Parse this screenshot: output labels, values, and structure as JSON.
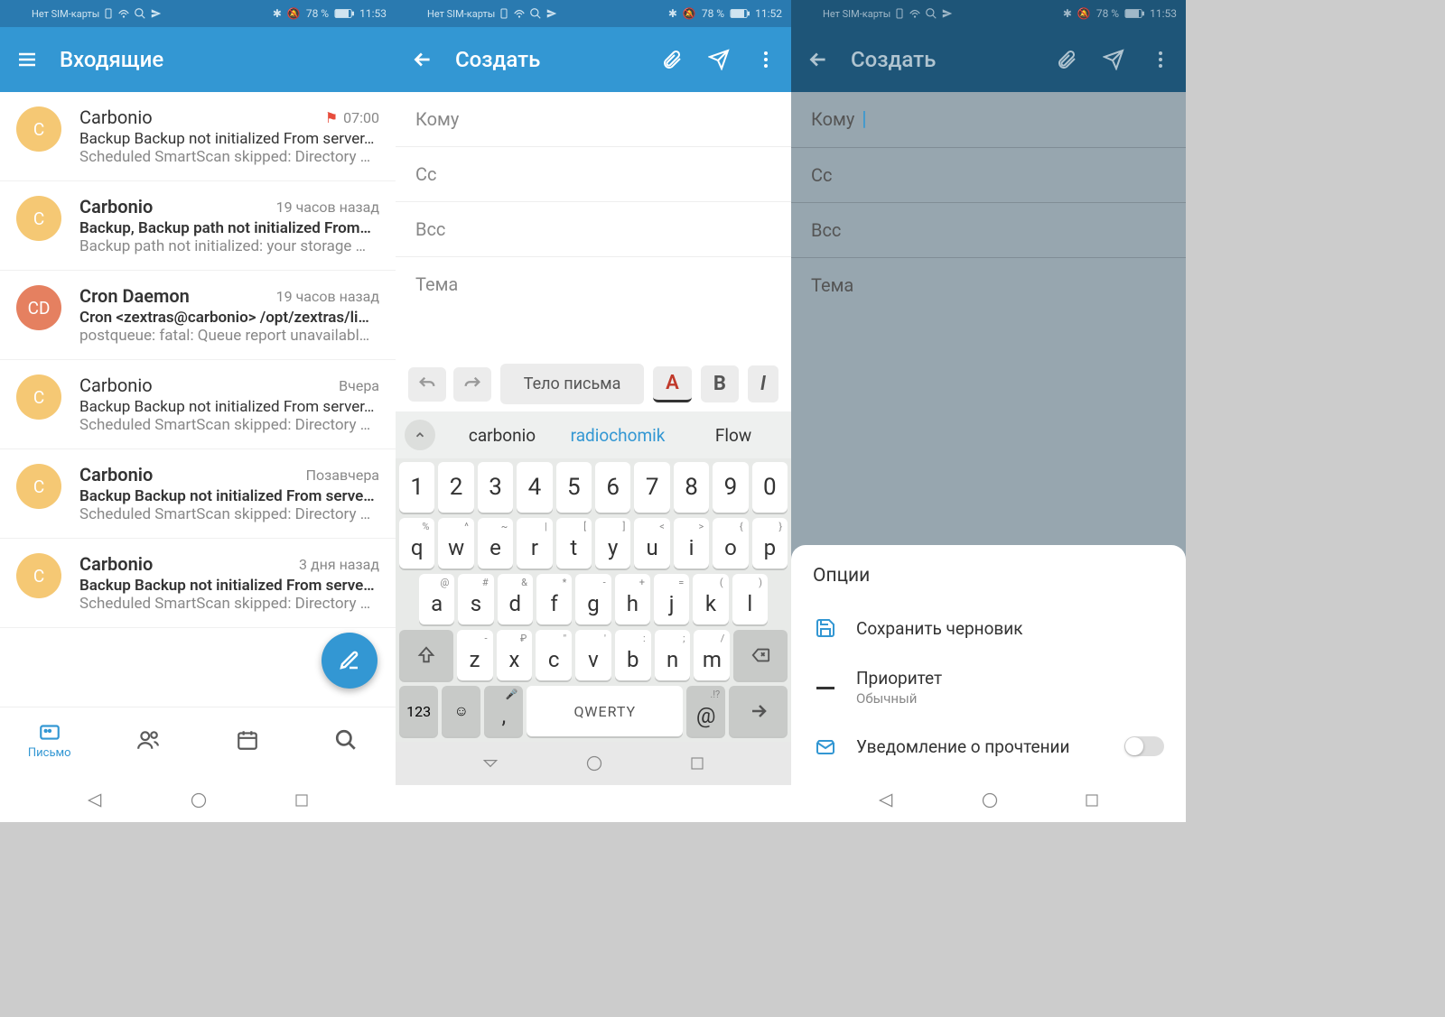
{
  "statusbar": {
    "sim": "Нет SIM-карты",
    "battery": "78 %",
    "time1": "11:53",
    "time2": "11:52",
    "time3": "11:53"
  },
  "screen1": {
    "title": "Входящие",
    "emails": [
      {
        "avatar": "C",
        "sender": "Carbonio",
        "time": "07:00",
        "flagged": true,
        "bold": false,
        "subject": "Backup Backup not initialized From server…",
        "preview": "Scheduled SmartScan skipped: Directory …"
      },
      {
        "avatar": "C",
        "sender": "Carbonio",
        "time": "19 часов назад",
        "flagged": false,
        "bold": true,
        "subject": "Backup, Backup path not initialized From…",
        "preview": "Backup path not initialized: your storage …"
      },
      {
        "avatar": "CD",
        "sender": "Cron Daemon",
        "time": "19 часов назад",
        "flagged": false,
        "bold": true,
        "subject": "Cron <zextras@carbonio> /opt/zextras/li…",
        "preview": "postqueue: fatal: Queue report unavailabl…"
      },
      {
        "avatar": "C",
        "sender": "Carbonio",
        "time": "Вчера",
        "flagged": false,
        "bold": false,
        "subject": "Backup Backup not initialized From server…",
        "preview": "Scheduled SmartScan skipped: Directory …"
      },
      {
        "avatar": "C",
        "sender": "Carbonio",
        "time": "Позавчера",
        "flagged": false,
        "bold": true,
        "subject": "Backup Backup not initialized From serve…",
        "preview": "Scheduled SmartScan skipped: Directory …"
      },
      {
        "avatar": "C",
        "sender": "Carbonio",
        "time": "3 дня назад",
        "flagged": false,
        "bold": true,
        "subject": "Backup Backup not initialized From serve…",
        "preview": "Scheduled SmartScan skipped: Directory …"
      }
    ],
    "nav": {
      "mail": "Письмо"
    }
  },
  "screen2": {
    "title": "Создать",
    "fields": {
      "to": "Кому",
      "cc": "Cc",
      "bcc": "Bcc",
      "subject": "Тема"
    },
    "body_placeholder": "Тело письма",
    "suggestions": [
      "carbonio",
      "radiochomik",
      "Flow"
    ],
    "space_label": "QWERTY",
    "num_label": "123"
  },
  "screen3": {
    "title": "Создать",
    "fields": {
      "to": "Кому",
      "cc": "Cc",
      "bcc": "Bcc",
      "subject": "Тема"
    },
    "options_title": "Опции",
    "opt_save": "Сохранить черновик",
    "opt_priority": "Приоритет",
    "opt_priority_value": "Обычный",
    "opt_read": "Уведомление о прочтении"
  }
}
